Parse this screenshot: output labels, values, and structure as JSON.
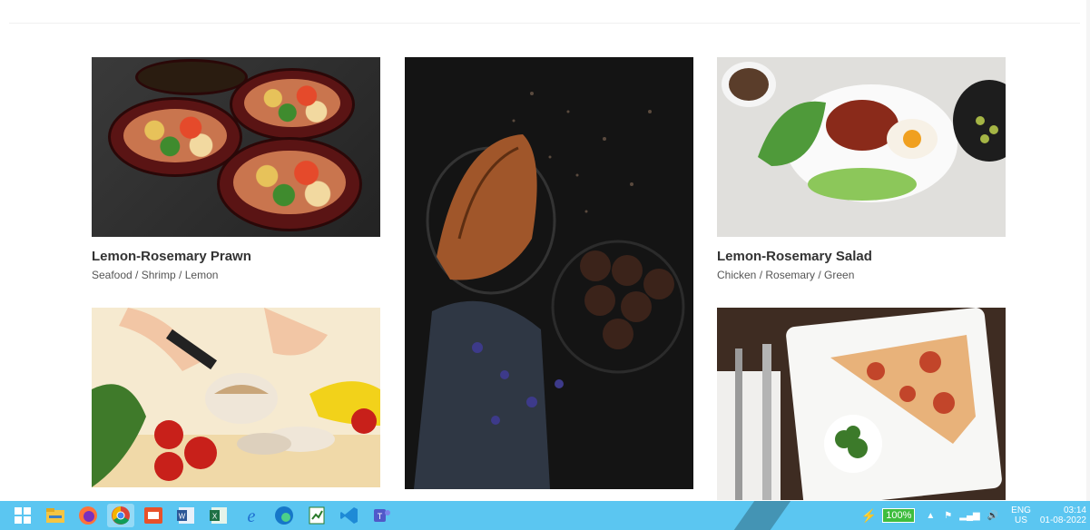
{
  "cards": [
    {
      "title": "Lemon-Rosemary Prawn",
      "tags": "Seafood / Shrimp / Lemon"
    },
    {
      "title": "Lemon-Rosemary Salad",
      "tags": "Chicken / Rosemary / Green"
    }
  ],
  "taskbar": {
    "apps": [
      "start-icon",
      "file-explorer-icon",
      "firefox-icon",
      "chrome-icon",
      "easy-connect-icon",
      "word-icon",
      "excel-icon",
      "internet-explorer-icon",
      "edge-icon",
      "notepad-icon",
      "vscode-icon",
      "teams-icon"
    ],
    "battery": "100%",
    "lang_top": "ENG",
    "lang_bottom": "US",
    "time": "03:14",
    "date": "01-08-2022"
  }
}
